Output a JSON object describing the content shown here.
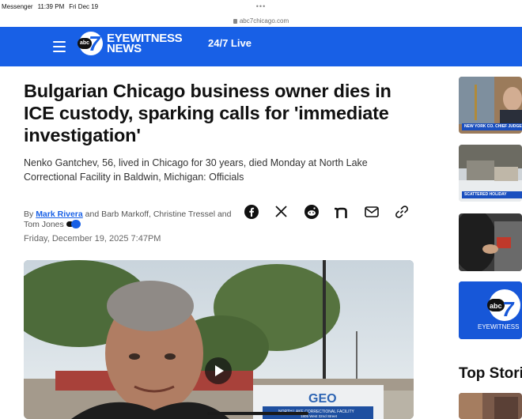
{
  "status_bar": {
    "app": "Messenger",
    "time": "11:39 PM",
    "date": "Fri Dec 19"
  },
  "browser": {
    "url": "abc7chicago.com"
  },
  "header": {
    "logo_line1": "EYEWITNESS",
    "logo_line2": "NEWS",
    "logo_abc": "abc",
    "logo_seven": "7",
    "live_label": "24/7 Live"
  },
  "article": {
    "headline": "Bulgarian Chicago business owner dies in ICE custody, sparking calls for 'immediate investigation'",
    "subhead": "Nenko Gantchev, 56, lived in Chicago for 30 years, died Monday at North Lake Correctional Facility in Baldwin, Michigan: Officials",
    "byline_prefix": "By",
    "author_link": "Mark Rivera",
    "byline_rest": "and Barb Markoff, Christine Tressel and Tom Jones",
    "date": "Friday, December 19, 2025 7:47PM"
  },
  "share_icons": [
    "facebook-icon",
    "x-icon",
    "reddit-icon",
    "nextdoor-icon",
    "email-icon",
    "link-icon"
  ],
  "video": {
    "sign_brand": "GEO",
    "sign_line1": "NORTH LAKE CORRECTIONAL FACILITY",
    "sign_line2": "1805 West 32nd Street"
  },
  "sidebar": {
    "thumb1_chyron": "NEW YORK CO. CHIEF JUDGE TO RESIGN",
    "thumb2_chyron": "SCATTERED HOLIDAY",
    "thumb4_caption": "EYEWITNESS",
    "top_stories_label": "Top Stories"
  },
  "colors": {
    "brand_blue": "#1860e6",
    "link_blue": "#1860e6"
  }
}
